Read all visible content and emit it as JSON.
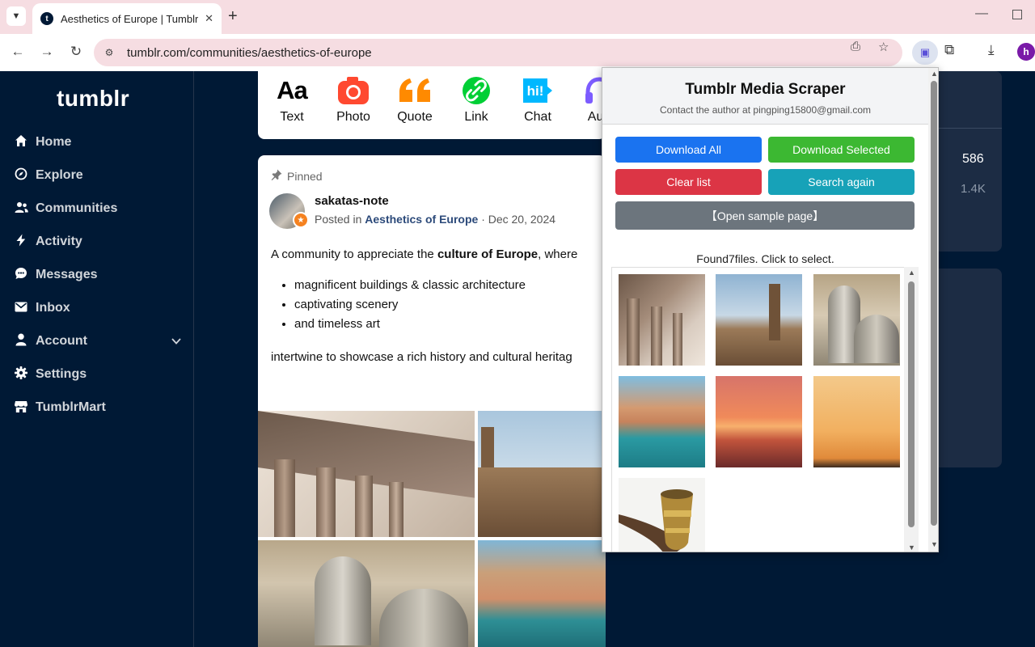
{
  "browser": {
    "tab_title": "Aesthetics of Europe | Tumblr",
    "tab_favicon": "t",
    "url": "tumblr.com/communities/aesthetics-of-europe",
    "profile_initial": "h"
  },
  "sidebar": {
    "logo": "tumblr",
    "items": [
      {
        "label": "Home",
        "icon": "home-icon"
      },
      {
        "label": "Explore",
        "icon": "compass-icon"
      },
      {
        "label": "Communities",
        "icon": "people-icon"
      },
      {
        "label": "Activity",
        "icon": "lightning-icon"
      },
      {
        "label": "Messages",
        "icon": "chat-bubble-icon"
      },
      {
        "label": "Inbox",
        "icon": "envelope-icon"
      },
      {
        "label": "Account",
        "icon": "person-icon"
      },
      {
        "label": "Settings",
        "icon": "gear-icon"
      },
      {
        "label": "TumblrMart",
        "icon": "store-icon"
      }
    ]
  },
  "post_types": [
    "Text",
    "Photo",
    "Quote",
    "Link",
    "Chat",
    "Aud"
  ],
  "post": {
    "pinned_label": "Pinned",
    "author": "sakatas-note",
    "posted_in_prefix": "Posted in",
    "community": "Aesthetics of Europe",
    "date": "· Dec 20, 2024",
    "intro_start": "A community to appreciate the ",
    "intro_bold": "culture of Europe",
    "intro_end": ", where",
    "bullets": [
      "magnificent buildings & classic architecture",
      "captivating scenery",
      "and timeless art"
    ],
    "closing": "intertwine to showcase a rich history and cultural heritag"
  },
  "right_stats": [
    "586",
    "1.4K"
  ],
  "popup": {
    "title": "Tumblr Media Scraper",
    "subtitle": "Contact the author at pingping15800@gmail.com",
    "buttons": {
      "download_all": "Download All",
      "download_selected": "Download Selected",
      "clear_list": "Clear list",
      "search_again": "Search again",
      "open_sample": "【Open sample page】"
    },
    "found_text": "Found7files. Click to select.",
    "file_count": 7
  },
  "colors": {
    "tumblr_navy": "#001935",
    "download_all": "#1a73f0",
    "download_selected": "#3cb832",
    "clear_list": "#dc3545",
    "search_again": "#17a2b8",
    "open_sample": "#6c757d",
    "tab_strip": "#f6dde2"
  }
}
